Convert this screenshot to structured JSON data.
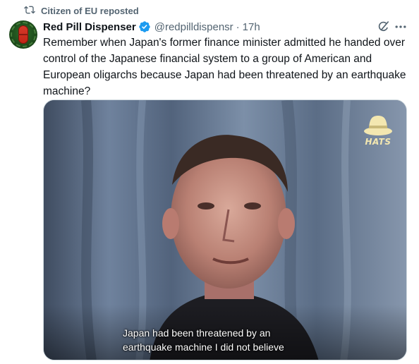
{
  "repost": {
    "label": "Citizen of EU reposted",
    "icon": "repost-icon"
  },
  "author": {
    "display_name": "Red Pill Dispenser",
    "handle": "@redpilldispensr",
    "separator": "·",
    "time": "17h",
    "verified_color": "#1d9bf0"
  },
  "tweet": {
    "text": "Remember when Japan's former finance minister admitted he handed over control of the Japanese financial system to a group of American and European oligarchs because Japan had been threatened by an earthquake machine?"
  },
  "media": {
    "watermark": "HATS",
    "subtitle_line1": "Japan had been threatened by an",
    "subtitle_line2": "earthquake machine I did not believe"
  },
  "colors": {
    "text": "#0f1419",
    "secondary": "#536471",
    "accent": "#1d9bf0"
  }
}
